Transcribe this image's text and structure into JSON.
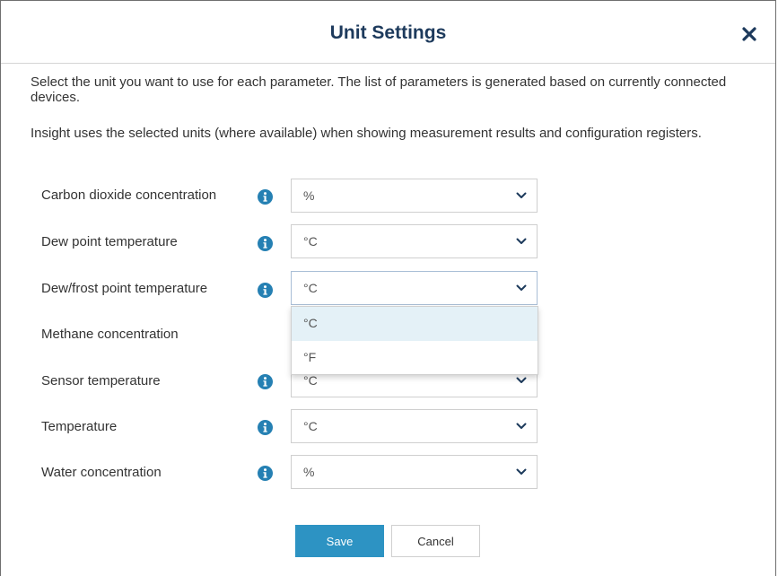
{
  "dialog": {
    "title": "Unit Settings",
    "description_1": "Select the unit you want to use for each parameter. The list of parameters is generated based on currently connected devices.",
    "description_2": "Insight uses the selected units (where available) when showing measurement results and configuration registers."
  },
  "parameters": [
    {
      "label": "Carbon dioxide concentration",
      "value": "%",
      "has_info": true
    },
    {
      "label": "Dew point temperature",
      "value": "°C",
      "has_info": true
    },
    {
      "label": "Dew/frost point temperature",
      "value": "°C",
      "has_info": true
    },
    {
      "label": "Methane concentration",
      "value": "",
      "has_info": false
    },
    {
      "label": "Sensor temperature",
      "value": "°C",
      "has_info": true
    },
    {
      "label": "Temperature",
      "value": "°C",
      "has_info": true
    },
    {
      "label": "Water concentration",
      "value": "%",
      "has_info": true
    }
  ],
  "open_dropdown": {
    "parameter": "Dew/frost point temperature",
    "options": [
      "°C",
      "°F"
    ],
    "highlighted": "°C"
  },
  "buttons": {
    "save_label": "Save",
    "cancel_label": "Cancel"
  },
  "icons": {
    "close": "close-icon",
    "info": "info-icon",
    "chevron": "chevron-down-icon"
  },
  "colors": {
    "title": "#1d3a5c",
    "info_icon": "#2580b3",
    "primary_button": "#2d93c3",
    "highlight": "#e4f1f7"
  }
}
